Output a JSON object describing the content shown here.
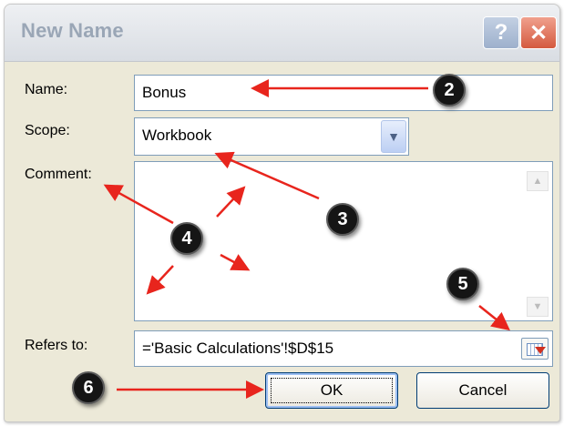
{
  "dialog": {
    "title": "New Name",
    "help_glyph": "?",
    "close_glyph": "✕"
  },
  "form": {
    "name_label": "Name:",
    "name_value": "Bonus",
    "scope_label": "Scope:",
    "scope_value": "Workbook",
    "comment_label": "Comment:",
    "comment_value": "",
    "refers_label": "Refers to:",
    "refers_value": "='Basic Calculations'!$D$15"
  },
  "buttons": {
    "ok_label": "OK",
    "cancel_label": "Cancel"
  },
  "annotations": [
    "2",
    "3",
    "4",
    "5",
    "6"
  ],
  "colors": {
    "annotation_arrow": "#e8251d",
    "dialog_bg": "#ece9d8",
    "field_border": "#7f9db9"
  },
  "icons": {
    "dropdown": "chevron-down-icon",
    "scroll_up": "scroll-up-icon",
    "scroll_down": "scroll-down-icon",
    "collapse": "collapse-dialog-icon"
  }
}
